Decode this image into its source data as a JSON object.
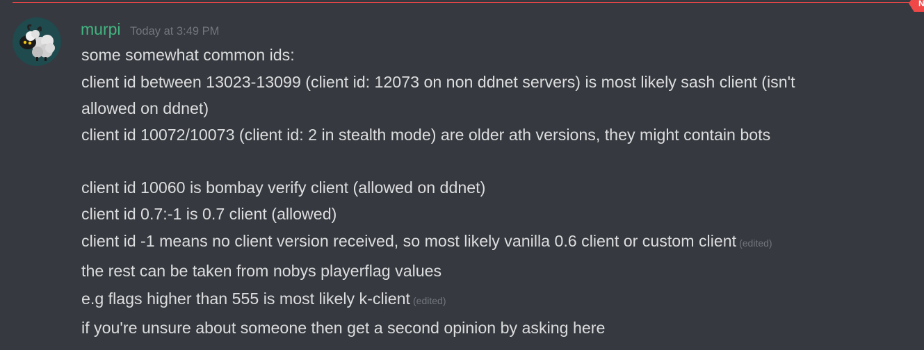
{
  "new_divider": {
    "badge": "N",
    "color": "#f04747"
  },
  "message": {
    "username": "murpi",
    "username_color": "#43b581",
    "timestamp": "Today at 3:49 PM",
    "avatar": {
      "icon": "sheep-avatar-icon"
    },
    "lines": [
      "some somewhat common ids:",
      "client id between 13023-13099 (client id: 12073 on non ddnet servers) is most likely sash client (isn't",
      "allowed on ddnet)",
      "client id 10072/10073 (client id: 2 in stealth mode) are older ath versions, they might contain bots",
      "",
      "client id 10060 is bombay verify client (allowed on ddnet)",
      "client id 0.7:-1 is 0.7 client (allowed)",
      "client id -1 means no client version received, so most likely vanilla 0.6 client or custom client",
      "the rest can be taken from nobys playerflag values",
      "e.g flags higher than 555 is most likely k-client",
      "if you're unsure about someone then get a second opinion by asking here"
    ],
    "edited_label": "(edited)"
  },
  "colors": {
    "background": "#36393f",
    "text": "#dcddde",
    "muted": "#72767d"
  }
}
